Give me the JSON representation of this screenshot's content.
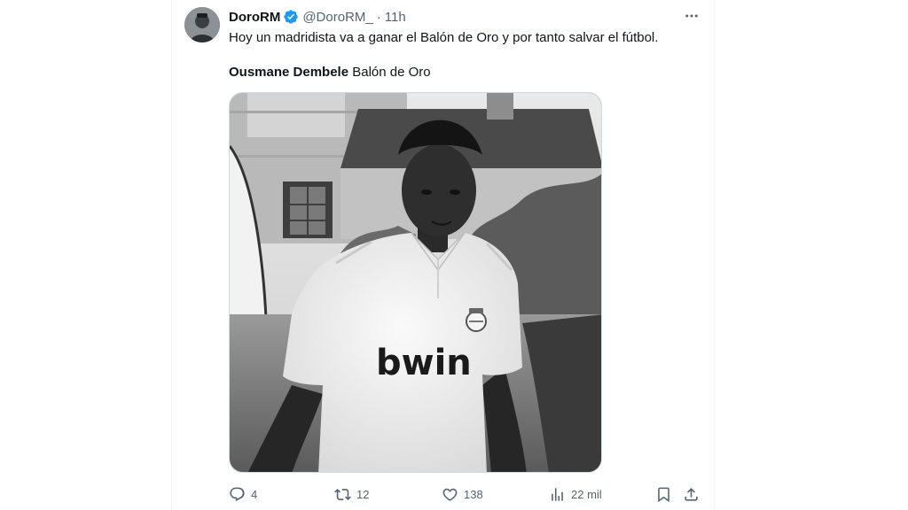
{
  "tweet": {
    "author_name": "DoroRM",
    "handle": "@DoroRM_",
    "separator": "·",
    "time": "11h",
    "text": "Hoy un madridista va a ganar el Balón de Oro y por tanto salvar el fútbol.",
    "caption_bold": "Ousmane Dembele",
    "caption_rest": "Balón de Oro",
    "photo_shirt_sponsor": "bwin"
  },
  "actions": {
    "replies": "4",
    "retweets": "12",
    "likes": "138",
    "views": "22 mil"
  },
  "colors": {
    "verified": "#1d9bf0",
    "muted_text": "#536471",
    "primary_text": "#0f1419"
  }
}
